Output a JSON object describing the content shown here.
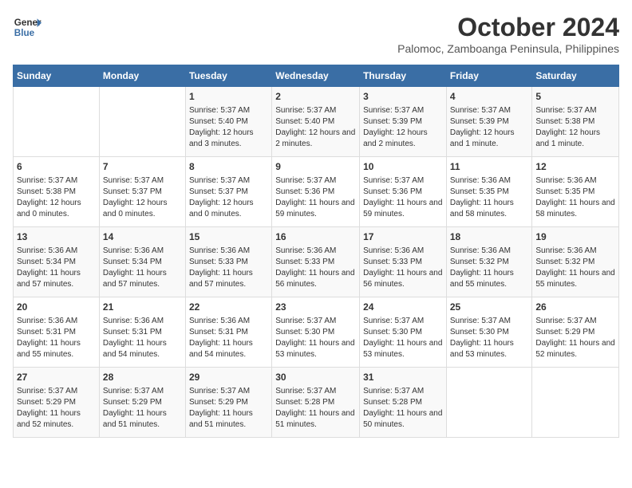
{
  "logo": {
    "line1": "General",
    "line2": "Blue"
  },
  "title": "October 2024",
  "subtitle": "Palomoc, Zamboanga Peninsula, Philippines",
  "headers": [
    "Sunday",
    "Monday",
    "Tuesday",
    "Wednesday",
    "Thursday",
    "Friday",
    "Saturday"
  ],
  "weeks": [
    [
      {
        "day": "",
        "content": ""
      },
      {
        "day": "",
        "content": ""
      },
      {
        "day": "1",
        "content": "Sunrise: 5:37 AM\nSunset: 5:40 PM\nDaylight: 12 hours and 3 minutes."
      },
      {
        "day": "2",
        "content": "Sunrise: 5:37 AM\nSunset: 5:40 PM\nDaylight: 12 hours and 2 minutes."
      },
      {
        "day": "3",
        "content": "Sunrise: 5:37 AM\nSunset: 5:39 PM\nDaylight: 12 hours and 2 minutes."
      },
      {
        "day": "4",
        "content": "Sunrise: 5:37 AM\nSunset: 5:39 PM\nDaylight: 12 hours and 1 minute."
      },
      {
        "day": "5",
        "content": "Sunrise: 5:37 AM\nSunset: 5:38 PM\nDaylight: 12 hours and 1 minute."
      }
    ],
    [
      {
        "day": "6",
        "content": "Sunrise: 5:37 AM\nSunset: 5:38 PM\nDaylight: 12 hours and 0 minutes."
      },
      {
        "day": "7",
        "content": "Sunrise: 5:37 AM\nSunset: 5:37 PM\nDaylight: 12 hours and 0 minutes."
      },
      {
        "day": "8",
        "content": "Sunrise: 5:37 AM\nSunset: 5:37 PM\nDaylight: 12 hours and 0 minutes."
      },
      {
        "day": "9",
        "content": "Sunrise: 5:37 AM\nSunset: 5:36 PM\nDaylight: 11 hours and 59 minutes."
      },
      {
        "day": "10",
        "content": "Sunrise: 5:37 AM\nSunset: 5:36 PM\nDaylight: 11 hours and 59 minutes."
      },
      {
        "day": "11",
        "content": "Sunrise: 5:36 AM\nSunset: 5:35 PM\nDaylight: 11 hours and 58 minutes."
      },
      {
        "day": "12",
        "content": "Sunrise: 5:36 AM\nSunset: 5:35 PM\nDaylight: 11 hours and 58 minutes."
      }
    ],
    [
      {
        "day": "13",
        "content": "Sunrise: 5:36 AM\nSunset: 5:34 PM\nDaylight: 11 hours and 57 minutes."
      },
      {
        "day": "14",
        "content": "Sunrise: 5:36 AM\nSunset: 5:34 PM\nDaylight: 11 hours and 57 minutes."
      },
      {
        "day": "15",
        "content": "Sunrise: 5:36 AM\nSunset: 5:33 PM\nDaylight: 11 hours and 57 minutes."
      },
      {
        "day": "16",
        "content": "Sunrise: 5:36 AM\nSunset: 5:33 PM\nDaylight: 11 hours and 56 minutes."
      },
      {
        "day": "17",
        "content": "Sunrise: 5:36 AM\nSunset: 5:33 PM\nDaylight: 11 hours and 56 minutes."
      },
      {
        "day": "18",
        "content": "Sunrise: 5:36 AM\nSunset: 5:32 PM\nDaylight: 11 hours and 55 minutes."
      },
      {
        "day": "19",
        "content": "Sunrise: 5:36 AM\nSunset: 5:32 PM\nDaylight: 11 hours and 55 minutes."
      }
    ],
    [
      {
        "day": "20",
        "content": "Sunrise: 5:36 AM\nSunset: 5:31 PM\nDaylight: 11 hours and 55 minutes."
      },
      {
        "day": "21",
        "content": "Sunrise: 5:36 AM\nSunset: 5:31 PM\nDaylight: 11 hours and 54 minutes."
      },
      {
        "day": "22",
        "content": "Sunrise: 5:36 AM\nSunset: 5:31 PM\nDaylight: 11 hours and 54 minutes."
      },
      {
        "day": "23",
        "content": "Sunrise: 5:37 AM\nSunset: 5:30 PM\nDaylight: 11 hours and 53 minutes."
      },
      {
        "day": "24",
        "content": "Sunrise: 5:37 AM\nSunset: 5:30 PM\nDaylight: 11 hours and 53 minutes."
      },
      {
        "day": "25",
        "content": "Sunrise: 5:37 AM\nSunset: 5:30 PM\nDaylight: 11 hours and 53 minutes."
      },
      {
        "day": "26",
        "content": "Sunrise: 5:37 AM\nSunset: 5:29 PM\nDaylight: 11 hours and 52 minutes."
      }
    ],
    [
      {
        "day": "27",
        "content": "Sunrise: 5:37 AM\nSunset: 5:29 PM\nDaylight: 11 hours and 52 minutes."
      },
      {
        "day": "28",
        "content": "Sunrise: 5:37 AM\nSunset: 5:29 PM\nDaylight: 11 hours and 51 minutes."
      },
      {
        "day": "29",
        "content": "Sunrise: 5:37 AM\nSunset: 5:29 PM\nDaylight: 11 hours and 51 minutes."
      },
      {
        "day": "30",
        "content": "Sunrise: 5:37 AM\nSunset: 5:28 PM\nDaylight: 11 hours and 51 minutes."
      },
      {
        "day": "31",
        "content": "Sunrise: 5:37 AM\nSunset: 5:28 PM\nDaylight: 11 hours and 50 minutes."
      },
      {
        "day": "",
        "content": ""
      },
      {
        "day": "",
        "content": ""
      }
    ]
  ]
}
